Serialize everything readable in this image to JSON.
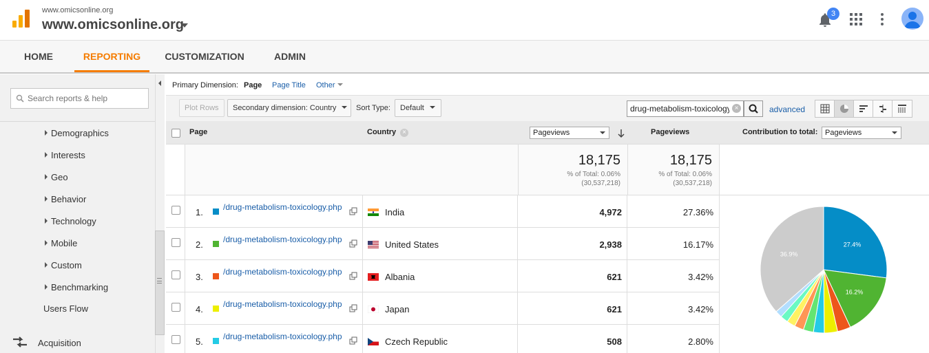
{
  "header": {
    "account_small": "www.omicsonline.org",
    "account_big": "www.omicsonline.org",
    "notification_count": "3"
  },
  "nav": {
    "tabs": [
      {
        "label": "HOME"
      },
      {
        "label": "REPORTING",
        "active": true
      },
      {
        "label": "CUSTOMIZATION"
      },
      {
        "label": "ADMIN"
      }
    ]
  },
  "sidebar": {
    "search_placeholder": "Search reports & help",
    "items": [
      "Demographics",
      "Interests",
      "Geo",
      "Behavior",
      "Technology",
      "Mobile",
      "Custom",
      "Benchmarking"
    ],
    "users_flow": "Users Flow",
    "acquisition": "Acquisition"
  },
  "dimension": {
    "label": "Primary Dimension:",
    "active": "Page",
    "page_title": "Page Title",
    "other": "Other"
  },
  "toolbar": {
    "plot_rows": "Plot Rows",
    "secondary": "Secondary dimension: Country",
    "sort_label": "Sort Type:",
    "sort_value": "Default",
    "filter_value": "drug-metabolism-toxicology",
    "advanced": "advanced"
  },
  "table": {
    "col_page": "Page",
    "col_country": "Country",
    "metric_select": "Pageviews",
    "col_pageviews": "Pageviews",
    "contribution_label": "Contribution to total:",
    "contribution_select": "Pageviews",
    "totals": {
      "value": "18,175",
      "pct_line": "% of Total: 0.06%",
      "total_line": "(30,537,218)"
    },
    "rows": [
      {
        "num": "1.",
        "page": "/drug-metabolism-toxicology.php",
        "country": "India",
        "value": "4,972",
        "pct": "27.36%",
        "color": "#058dc7",
        "flag": "in"
      },
      {
        "num": "2.",
        "page": "/drug-metabolism-toxicology.php",
        "country": "United States",
        "value": "2,938",
        "pct": "16.17%",
        "color": "#50b432",
        "flag": "us"
      },
      {
        "num": "3.",
        "page": "/drug-metabolism-toxicology.php",
        "country": "Albania",
        "value": "621",
        "pct": "3.42%",
        "color": "#ed561b",
        "flag": "al"
      },
      {
        "num": "4.",
        "page": "/drug-metabolism-toxicology.php",
        "country": "Japan",
        "value": "621",
        "pct": "3.42%",
        "color": "#edef00",
        "flag": "jp"
      },
      {
        "num": "5.",
        "page": "/drug-metabolism-toxicology.php",
        "country": "Czech Republic",
        "value": "508",
        "pct": "2.80%",
        "color": "#24cbe5",
        "flag": "cz"
      }
    ]
  },
  "chart_data": {
    "type": "pie",
    "values": [
      27.36,
      16.17,
      3.42,
      3.42,
      2.8,
      2.6,
      2.4,
      2.2,
      2.0,
      1.8,
      36.9
    ],
    "colors": [
      "#058dc7",
      "#50b432",
      "#ed561b",
      "#edef00",
      "#24cbe5",
      "#64e572",
      "#ff9655",
      "#fff263",
      "#6af9c4",
      "#b2deff",
      "#cccccc"
    ],
    "labels": [
      "27.4%",
      "16.2%",
      "",
      "",
      "",
      "",
      "",
      "",
      "",
      "",
      "36.9%"
    ]
  }
}
